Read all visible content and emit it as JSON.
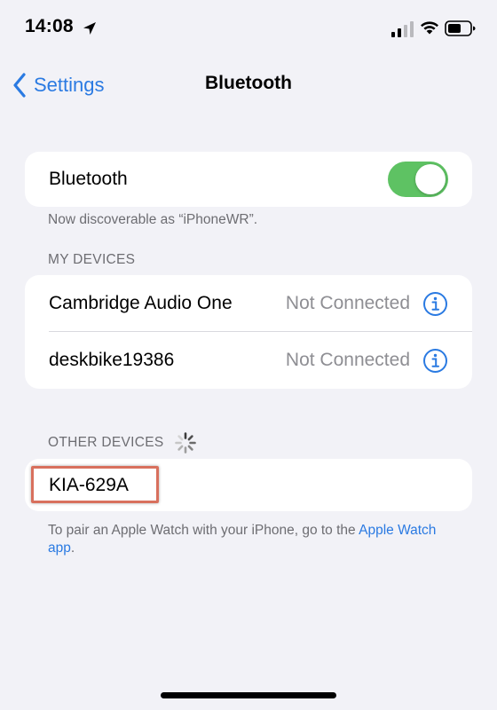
{
  "status_bar": {
    "time": "14:08",
    "icons": [
      "location-arrow-icon",
      "cellular-signal-icon",
      "wifi-icon",
      "battery-icon"
    ]
  },
  "nav": {
    "back_label": "Settings",
    "title": "Bluetooth"
  },
  "bluetooth": {
    "label": "Bluetooth",
    "enabled": true,
    "discoverable_text": "Now discoverable as “iPhoneWR”."
  },
  "my_devices": {
    "header": "MY DEVICES",
    "items": [
      {
        "name": "Cambridge Audio One",
        "status": "Not Connected"
      },
      {
        "name": "deskbike19386",
        "status": "Not Connected"
      }
    ]
  },
  "other_devices": {
    "header": "OTHER DEVICES",
    "items": [
      {
        "name": "KIA-629A"
      }
    ]
  },
  "pair_note": {
    "text": "To pair an Apple Watch with your iPhone, go to the ",
    "link": "Apple Watch app",
    "suffix": "."
  },
  "colors": {
    "accent": "#2a7ae2",
    "toggle_on": "#5ec263",
    "background": "#f2f2f7",
    "highlight": "#d8705d"
  }
}
